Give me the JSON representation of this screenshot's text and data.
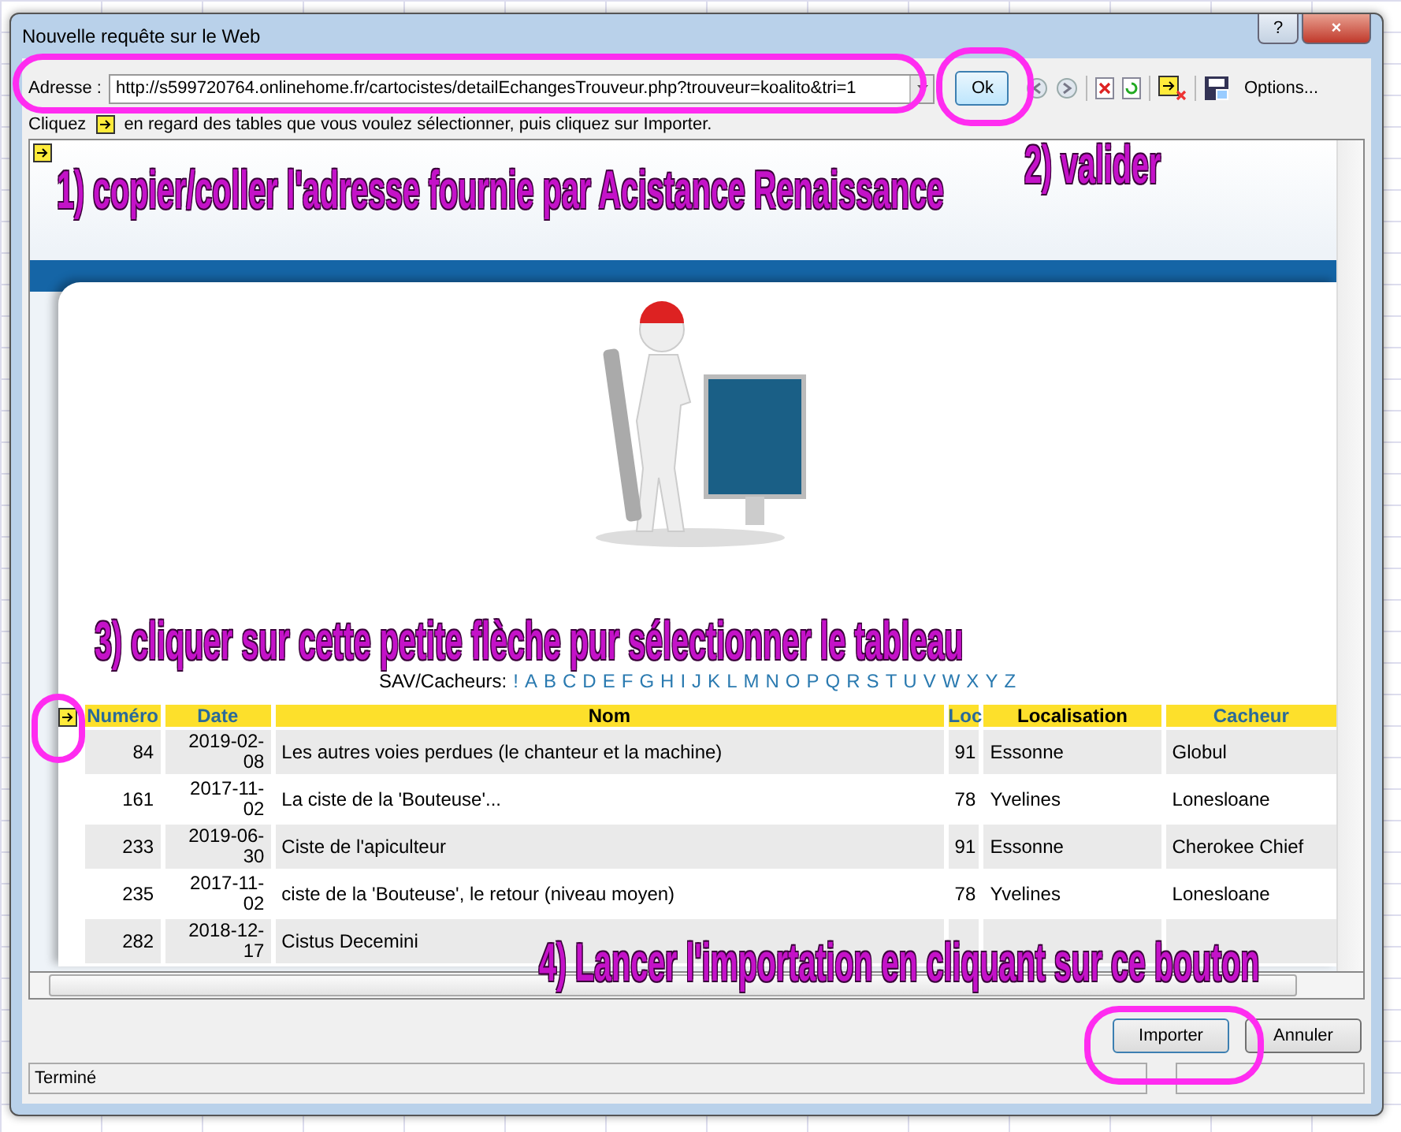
{
  "window": {
    "title": "Nouvelle requête sur le Web",
    "help_button": "?",
    "close_button": "×"
  },
  "address": {
    "label": "Adresse :",
    "value": "http://s599720764.onlinehome.fr/cartocistes/detailEchangesTrouveur.php?trouveur=koalito&tri=1",
    "go_button": "Ok",
    "options_button": "Options..."
  },
  "hint": {
    "before": "Cliquez",
    "after": "en regard des tables que vous voulez sélectionner, puis cliquez sur Importer."
  },
  "letters": {
    "label": "SAV/Cacheurs:",
    "items": [
      "!",
      "A",
      "B",
      "C",
      "D",
      "E",
      "F",
      "G",
      "H",
      "I",
      "J",
      "K",
      "L",
      "M",
      "N",
      "O",
      "P",
      "Q",
      "R",
      "S",
      "T",
      "U",
      "V",
      "W",
      "X",
      "Y",
      "Z"
    ]
  },
  "table": {
    "columns": [
      {
        "label": "Numéro",
        "sortable": true
      },
      {
        "label": "Date",
        "sortable": true
      },
      {
        "label": "Nom",
        "sortable": false
      },
      {
        "label": "Loc",
        "sortable": true
      },
      {
        "label": "Localisation",
        "sortable": false
      },
      {
        "label": "Cacheur",
        "sortable": true
      }
    ],
    "rows": [
      [
        "84",
        "2019-02-08",
        "Les autres voies perdues (le chanteur et la machine)",
        "91",
        "Essonne",
        "Globul"
      ],
      [
        "161",
        "2017-11-02",
        " La ciste de la 'Bouteuse'...",
        "78",
        "Yvelines",
        "Lonesloane"
      ],
      [
        "233",
        "2019-06-30",
        "Ciste de l'apiculteur",
        "91",
        "Essonne",
        "Cherokee Chief"
      ],
      [
        "235",
        "2017-11-02",
        " ciste de la 'Bouteuse', le retour (niveau moyen)",
        "78",
        "Yvelines",
        "Lonesloane"
      ],
      [
        "282",
        "2018-12-17",
        "Cistus Decemini",
        "",
        "",
        ""
      ]
    ]
  },
  "buttons": [
    {
      "label": "Importer",
      "kind": "primary"
    },
    {
      "label": "Annuler",
      "kind": "normal"
    }
  ],
  "status_bar": "Terminé",
  "annotations": [
    {
      "kind": "address",
      "text": "1) copier/coller l'adresse fournie par Acistance Renaissance"
    },
    {
      "kind": "validate",
      "text": "2) valider"
    },
    {
      "kind": "table-arrow",
      "text": "3) cliquer sur cette petite flèche pur sélectionner le tableau"
    },
    {
      "kind": "import",
      "text": "4) Lancer l'importation en cliquant sur ce bouton"
    }
  ]
}
